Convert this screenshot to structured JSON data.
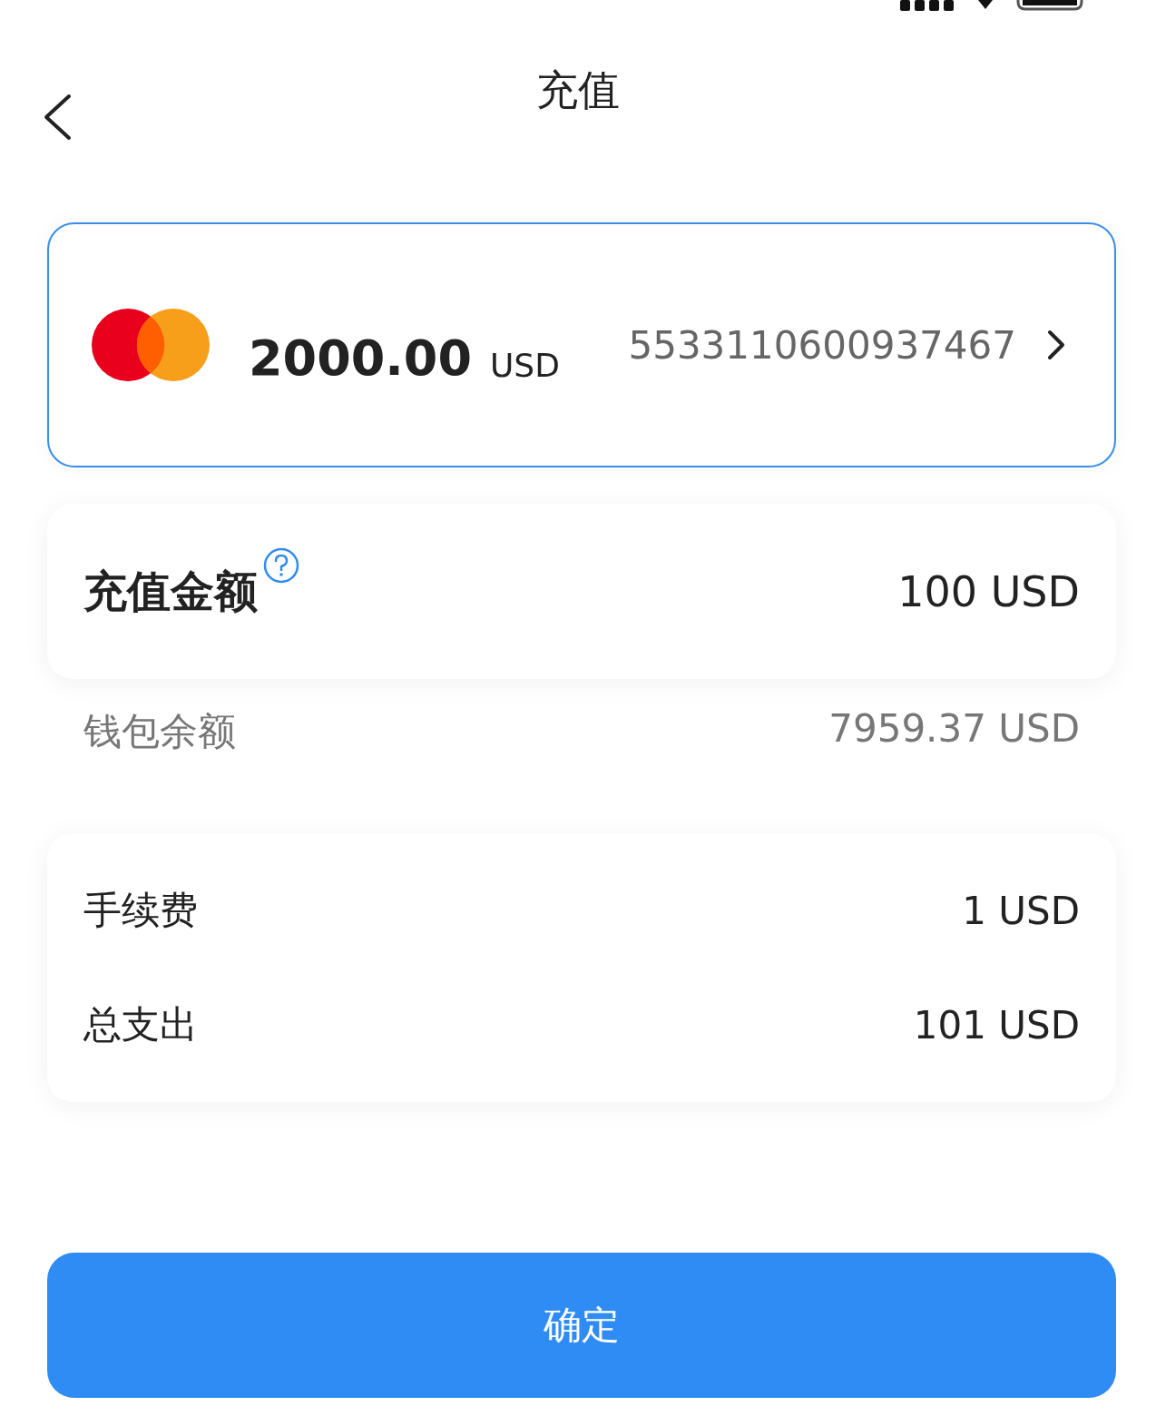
{
  "nav": {
    "title": "充值"
  },
  "card": {
    "balance": "2000.00",
    "currency": "USD",
    "number": "5533110600937467"
  },
  "amount": {
    "label": "充值金额",
    "value": "100 USD"
  },
  "wallet": {
    "label": "钱包余额",
    "value": "7959.37 USD"
  },
  "fees": [
    {
      "label": "手续费",
      "value": "1 USD"
    },
    {
      "label": "总支出",
      "value": "101 USD"
    }
  ],
  "confirm": {
    "label": "确定"
  }
}
